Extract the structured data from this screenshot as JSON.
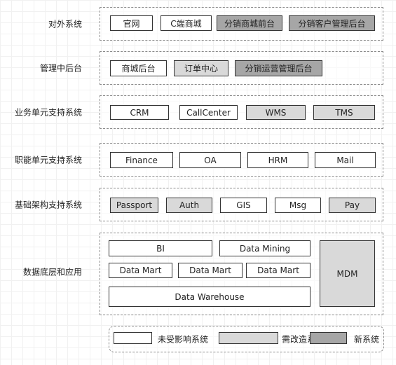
{
  "colors": {
    "unaffected": "#ffffff",
    "modified": "#d9d9d9",
    "new": "#a6a6a6"
  },
  "layers": [
    {
      "label": "对外系统",
      "systems": [
        {
          "name": "官网",
          "status": "unaffected"
        },
        {
          "name": "C端商城",
          "status": "unaffected"
        },
        {
          "name": "分销商城前台",
          "status": "new"
        },
        {
          "name": "分销客户管理后台",
          "status": "new"
        }
      ]
    },
    {
      "label": "管理中后台",
      "systems": [
        {
          "name": "商城后台",
          "status": "unaffected"
        },
        {
          "name": "订单中心",
          "status": "modified"
        },
        {
          "name": "分销运营管理后台",
          "status": "new"
        }
      ]
    },
    {
      "label": "业务单元支持系统",
      "systems": [
        {
          "name": "CRM",
          "status": "unaffected"
        },
        {
          "name": "CallCenter",
          "status": "unaffected"
        },
        {
          "name": "WMS",
          "status": "modified"
        },
        {
          "name": "TMS",
          "status": "modified"
        }
      ]
    },
    {
      "label": "职能单元支持系统",
      "systems": [
        {
          "name": "Finance",
          "status": "unaffected"
        },
        {
          "name": "OA",
          "status": "unaffected"
        },
        {
          "name": "HRM",
          "status": "unaffected"
        },
        {
          "name": "Mail",
          "status": "unaffected"
        }
      ]
    },
    {
      "label": "基础架构支持系统",
      "systems": [
        {
          "name": "Passport",
          "status": "modified"
        },
        {
          "name": "Auth",
          "status": "modified"
        },
        {
          "name": "GIS",
          "status": "unaffected"
        },
        {
          "name": "Msg",
          "status": "unaffected"
        },
        {
          "name": "Pay",
          "status": "modified"
        }
      ]
    },
    {
      "label": "数据底层和应用",
      "systems": [
        {
          "name": "BI",
          "status": "unaffected"
        },
        {
          "name": "Data Mining",
          "status": "unaffected"
        },
        {
          "name": "Data Mart",
          "status": "unaffected"
        },
        {
          "name": "Data Mart",
          "status": "unaffected"
        },
        {
          "name": "Data Mart",
          "status": "unaffected"
        },
        {
          "name": "Data Warehouse",
          "status": "unaffected"
        },
        {
          "name": "MDM",
          "status": "modified"
        }
      ]
    }
  ],
  "legend": [
    {
      "label": "未受影响系统",
      "status": "unaffected"
    },
    {
      "label": "需改造系统",
      "status": "modified"
    },
    {
      "label": "新系统",
      "status": "new"
    }
  ]
}
